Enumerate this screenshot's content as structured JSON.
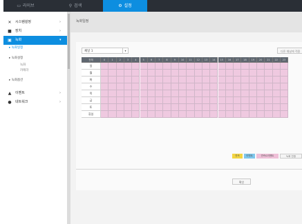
{
  "tabs": [
    {
      "label": "라이브",
      "icon": "monitor-icon"
    },
    {
      "label": "검색",
      "icon": "search-icon"
    },
    {
      "label": "설정",
      "icon": "gear-icon"
    }
  ],
  "sidebar": {
    "items": [
      {
        "label": "시스템설정",
        "icon": "tools-icon"
      },
      {
        "label": "장치",
        "icon": "camera-icon"
      },
      {
        "label": "녹화",
        "icon": "record-icon"
      },
      {
        "label": "이벤트",
        "icon": "bell-icon"
      },
      {
        "label": "네트워크",
        "icon": "globe-icon"
      }
    ],
    "record_subitems": [
      "녹화일정",
      "녹화설정"
    ],
    "record_settings_children": [
      "녹화",
      "카메라"
    ],
    "extra_item": "녹화옵션"
  },
  "page_title": "녹화일정",
  "camera_select": "채널 1",
  "top_right_button": "다른 채널에 적용",
  "schedule": {
    "header_label": "전체",
    "hours": [
      "0",
      "1",
      "2",
      "3",
      "4",
      "5",
      "6",
      "7",
      "8",
      "9",
      "10",
      "11",
      "12",
      "13",
      "14",
      "15",
      "16",
      "17",
      "18",
      "19",
      "20",
      "21",
      "22",
      "23"
    ],
    "days": [
      "일",
      "월",
      "화",
      "수",
      "목",
      "금",
      "토",
      "휴일"
    ]
  },
  "legend": [
    "연속",
    "이벤트",
    "연속&이벤트",
    "녹화 안함"
  ],
  "ok_button": "확인",
  "colors": {
    "accent": "#0d8ee0",
    "continuous": "#f3d542",
    "event": "#7fc7ec",
    "both": "#efc0d8",
    "topbar": "#2a2f36"
  }
}
